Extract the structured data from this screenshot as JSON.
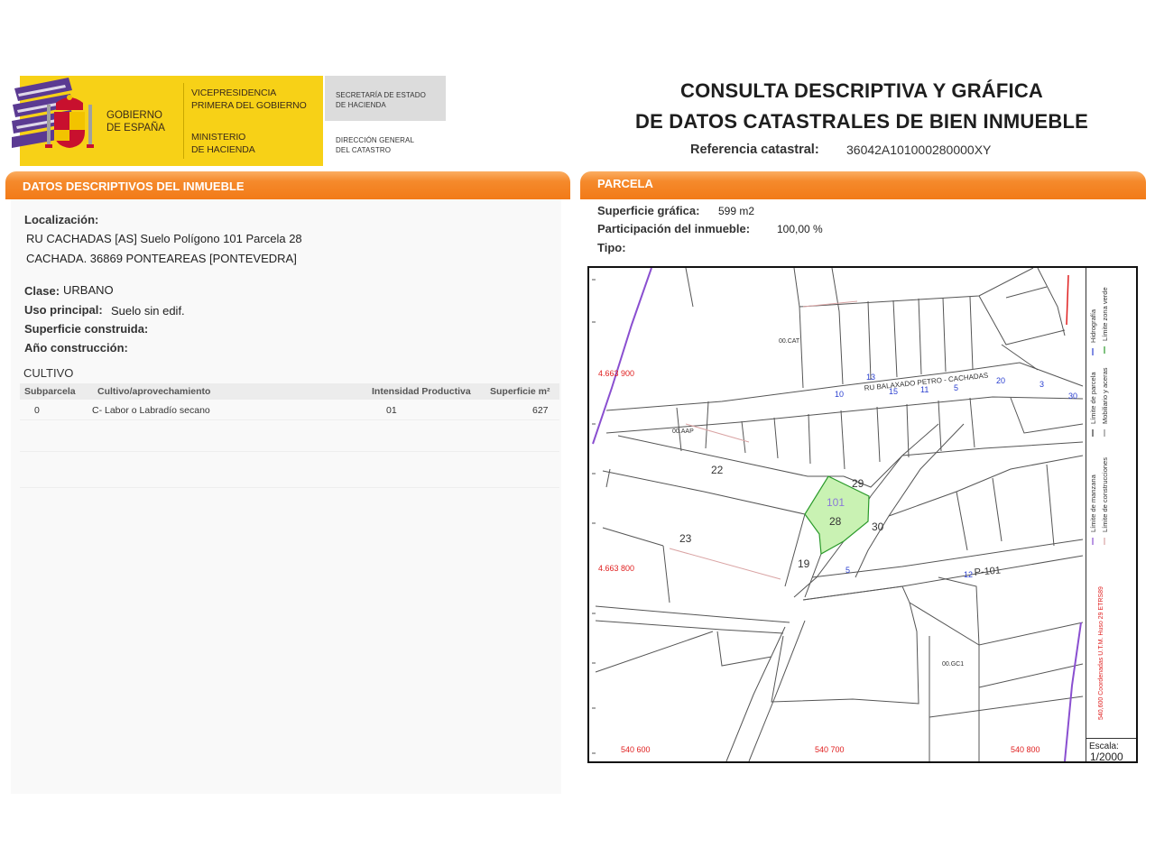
{
  "header": {
    "emblem": "government-of-spain-emblem",
    "gov_lines": [
      "GOBIERNO",
      "DE ESPAÑA"
    ],
    "vice_lines": [
      "VICEPRESIDENCIA",
      "PRIMERA DEL GOBIERNO"
    ],
    "ministry_lines": [
      "MINISTERIO",
      "DE HACIENDA"
    ],
    "secretary_lines": [
      "SECRETARÍA DE ESTADO",
      "DE HACIENDA"
    ],
    "directorate_lines": [
      "DIRECCIÓN GENERAL",
      "DEL CATASTRO"
    ],
    "title_lines": [
      "CONSULTA DESCRIPTIVA Y GRÁFICA",
      "DE DATOS CATASTRALES DE BIEN INMUEBLE"
    ],
    "reference_label": "Referencia catastral:",
    "reference_value": "36042A101000280000XY"
  },
  "descriptive": {
    "section_title": "DATOS DESCRIPTIVOS DEL INMUEBLE",
    "location_label": "Localización:",
    "location_lines": [
      "RU CACHADAS [AS]  Suelo Polígono 101 Parcela 28",
      "CACHADA. 36869 PONTEAREAS [PONTEVEDRA]"
    ],
    "class_label": "Clase:",
    "class_value": "URBANO",
    "use_label": "Uso principal:",
    "use_value": "Suelo sin edif.",
    "built_area_label": "Superficie construida:",
    "year_label": "Año construcción:",
    "crop_title": "CULTIVO",
    "crop_table": {
      "headers": [
        "Subparcela",
        "Cultivo/aprovechamiento",
        "Intensidad Productiva",
        "Superficie m²"
      ],
      "rows": [
        [
          "0",
          "C- Labor o Labradío secano",
          "01",
          "627"
        ]
      ]
    }
  },
  "parcel": {
    "section_title": "PARCELA",
    "area_label": "Superficie gráfica:",
    "area_value": "599 m2",
    "share_label": "Participación del inmueble:",
    "share_value": "100,00 %",
    "type_label": "Tipo:",
    "map": {
      "coordinate_labels": [
        "4.663 900",
        "4.663 800",
        "540 600",
        "540 700",
        "540 800"
      ],
      "plot_numbers": [
        "22",
        "23",
        "19",
        "29",
        "30"
      ],
      "highlighted": {
        "polygon": "101",
        "plot": "28"
      },
      "street_numbers": [
        "13",
        "15",
        "11",
        "5",
        "20",
        "3",
        "30",
        "10",
        "5",
        "12"
      ],
      "road_labels": [
        "RU  BALAXADO PETRO - CACHADAS",
        "P-101"
      ],
      "feature_codes": [
        "00.CAT",
        "00.AAP",
        "00.GC1"
      ],
      "legend": [
        "Hidrografía",
        "Límite de parcela",
        "Límite de manzana",
        "Límite zona verde",
        "Mobiliario y aceras",
        "Límite de construcciones"
      ],
      "projection_note": "540,600 Coordenadas U.T.M. Huso 29 ETRS89",
      "scale_label": "Escala:",
      "scale_value": "1/2000"
    }
  },
  "colors": {
    "accent_orange": "#f27a18",
    "logo_yellow": "#f7d117",
    "logo_purple": "#5b3a92",
    "parcel_fill": "#c9f2b3",
    "coordinate_red": "#e02020",
    "hydrography_purple": "#8a4fd0",
    "number_blue": "#2a3fd0"
  }
}
